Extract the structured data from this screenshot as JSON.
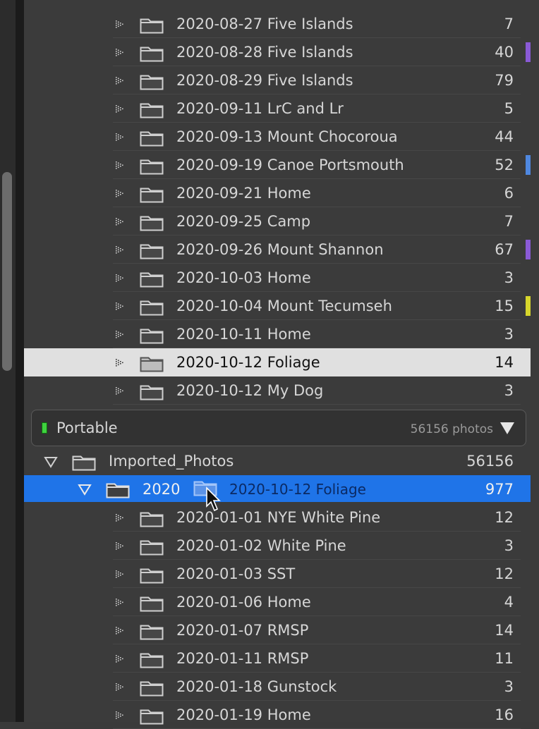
{
  "folders_top": [
    {
      "name": "2020-08-27 Five Islands",
      "count": "7",
      "flag": ""
    },
    {
      "name": "2020-08-28 Five Islands",
      "count": "40",
      "flag": "#8a5ad6"
    },
    {
      "name": "2020-08-29 Five Islands",
      "count": "79",
      "flag": ""
    },
    {
      "name": "2020-09-11 LrC and Lr",
      "count": "5",
      "flag": ""
    },
    {
      "name": "2020-09-13 Mount Chocoroua",
      "count": "44",
      "flag": ""
    },
    {
      "name": "2020-09-19 Canoe Portsmouth",
      "count": "52",
      "flag": "#4f88e0"
    },
    {
      "name": "2020-09-21 Home",
      "count": "6",
      "flag": ""
    },
    {
      "name": "2020-09-25 Camp",
      "count": "7",
      "flag": ""
    },
    {
      "name": "2020-09-26 Mount Shannon",
      "count": "67",
      "flag": "#8a5ad6"
    },
    {
      "name": "2020-10-03 Home",
      "count": "3",
      "flag": ""
    },
    {
      "name": "2020-10-04 Mount Tecumseh",
      "count": "15",
      "flag": "#d7d62c"
    },
    {
      "name": "2020-10-11 Home",
      "count": "3",
      "flag": ""
    },
    {
      "name": "2020-10-12 Foliage",
      "count": "14",
      "flag": "",
      "selected": true
    },
    {
      "name": "2020-10-12 My Dog",
      "count": "3",
      "flag": ""
    }
  ],
  "volume": {
    "name": "Portable",
    "count": "56156 photos",
    "status_color": "#3fd23f"
  },
  "root_folder": {
    "name": "Imported_Photos",
    "count": "56156"
  },
  "year_folder": {
    "name": "2020",
    "count": "977",
    "drag_label": "2020-10-12 Foliage"
  },
  "folders_bottom": [
    {
      "name": "2020-01-01 NYE White Pine",
      "count": "12"
    },
    {
      "name": "2020-01-02 White Pine",
      "count": "3"
    },
    {
      "name": "2020-01-03 SST",
      "count": "12"
    },
    {
      "name": "2020-01-06 Home",
      "count": "4"
    },
    {
      "name": "2020-01-07 RMSP",
      "count": "14"
    },
    {
      "name": "2020-01-11 RMSP",
      "count": "11"
    },
    {
      "name": "2020-01-18 Gunstock",
      "count": "3"
    },
    {
      "name": "2020-01-19 Home",
      "count": "16"
    }
  ],
  "icons": {
    "folder": "folder-icon",
    "grip": "drag-grip-icon",
    "expand": "triangle-down-icon",
    "cursor": "pointer-cursor-icon"
  },
  "colors": {
    "selection_blue": "#1f74e8",
    "selected_row": "#e0e0e0",
    "panel_bg": "#3b3b3b"
  }
}
